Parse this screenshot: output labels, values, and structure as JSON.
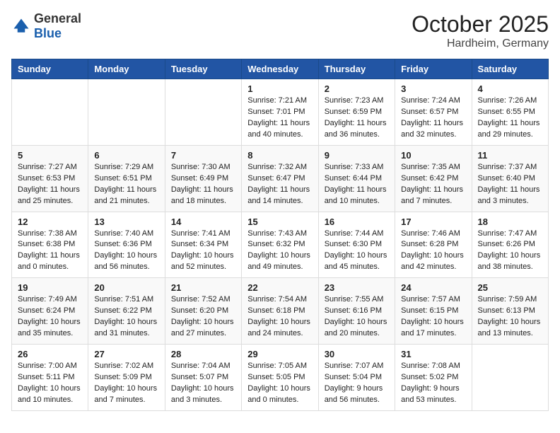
{
  "header": {
    "logo_general": "General",
    "logo_blue": "Blue",
    "month": "October 2025",
    "location": "Hardheim, Germany"
  },
  "weekdays": [
    "Sunday",
    "Monday",
    "Tuesday",
    "Wednesday",
    "Thursday",
    "Friday",
    "Saturday"
  ],
  "weeks": [
    [
      {
        "day": "",
        "info": ""
      },
      {
        "day": "",
        "info": ""
      },
      {
        "day": "",
        "info": ""
      },
      {
        "day": "1",
        "info": "Sunrise: 7:21 AM\nSunset: 7:01 PM\nDaylight: 11 hours\nand 40 minutes."
      },
      {
        "day": "2",
        "info": "Sunrise: 7:23 AM\nSunset: 6:59 PM\nDaylight: 11 hours\nand 36 minutes."
      },
      {
        "day": "3",
        "info": "Sunrise: 7:24 AM\nSunset: 6:57 PM\nDaylight: 11 hours\nand 32 minutes."
      },
      {
        "day": "4",
        "info": "Sunrise: 7:26 AM\nSunset: 6:55 PM\nDaylight: 11 hours\nand 29 minutes."
      }
    ],
    [
      {
        "day": "5",
        "info": "Sunrise: 7:27 AM\nSunset: 6:53 PM\nDaylight: 11 hours\nand 25 minutes."
      },
      {
        "day": "6",
        "info": "Sunrise: 7:29 AM\nSunset: 6:51 PM\nDaylight: 11 hours\nand 21 minutes."
      },
      {
        "day": "7",
        "info": "Sunrise: 7:30 AM\nSunset: 6:49 PM\nDaylight: 11 hours\nand 18 minutes."
      },
      {
        "day": "8",
        "info": "Sunrise: 7:32 AM\nSunset: 6:47 PM\nDaylight: 11 hours\nand 14 minutes."
      },
      {
        "day": "9",
        "info": "Sunrise: 7:33 AM\nSunset: 6:44 PM\nDaylight: 11 hours\nand 10 minutes."
      },
      {
        "day": "10",
        "info": "Sunrise: 7:35 AM\nSunset: 6:42 PM\nDaylight: 11 hours\nand 7 minutes."
      },
      {
        "day": "11",
        "info": "Sunrise: 7:37 AM\nSunset: 6:40 PM\nDaylight: 11 hours\nand 3 minutes."
      }
    ],
    [
      {
        "day": "12",
        "info": "Sunrise: 7:38 AM\nSunset: 6:38 PM\nDaylight: 11 hours\nand 0 minutes."
      },
      {
        "day": "13",
        "info": "Sunrise: 7:40 AM\nSunset: 6:36 PM\nDaylight: 10 hours\nand 56 minutes."
      },
      {
        "day": "14",
        "info": "Sunrise: 7:41 AM\nSunset: 6:34 PM\nDaylight: 10 hours\nand 52 minutes."
      },
      {
        "day": "15",
        "info": "Sunrise: 7:43 AM\nSunset: 6:32 PM\nDaylight: 10 hours\nand 49 minutes."
      },
      {
        "day": "16",
        "info": "Sunrise: 7:44 AM\nSunset: 6:30 PM\nDaylight: 10 hours\nand 45 minutes."
      },
      {
        "day": "17",
        "info": "Sunrise: 7:46 AM\nSunset: 6:28 PM\nDaylight: 10 hours\nand 42 minutes."
      },
      {
        "day": "18",
        "info": "Sunrise: 7:47 AM\nSunset: 6:26 PM\nDaylight: 10 hours\nand 38 minutes."
      }
    ],
    [
      {
        "day": "19",
        "info": "Sunrise: 7:49 AM\nSunset: 6:24 PM\nDaylight: 10 hours\nand 35 minutes."
      },
      {
        "day": "20",
        "info": "Sunrise: 7:51 AM\nSunset: 6:22 PM\nDaylight: 10 hours\nand 31 minutes."
      },
      {
        "day": "21",
        "info": "Sunrise: 7:52 AM\nSunset: 6:20 PM\nDaylight: 10 hours\nand 27 minutes."
      },
      {
        "day": "22",
        "info": "Sunrise: 7:54 AM\nSunset: 6:18 PM\nDaylight: 10 hours\nand 24 minutes."
      },
      {
        "day": "23",
        "info": "Sunrise: 7:55 AM\nSunset: 6:16 PM\nDaylight: 10 hours\nand 20 minutes."
      },
      {
        "day": "24",
        "info": "Sunrise: 7:57 AM\nSunset: 6:15 PM\nDaylight: 10 hours\nand 17 minutes."
      },
      {
        "day": "25",
        "info": "Sunrise: 7:59 AM\nSunset: 6:13 PM\nDaylight: 10 hours\nand 13 minutes."
      }
    ],
    [
      {
        "day": "26",
        "info": "Sunrise: 7:00 AM\nSunset: 5:11 PM\nDaylight: 10 hours\nand 10 minutes."
      },
      {
        "day": "27",
        "info": "Sunrise: 7:02 AM\nSunset: 5:09 PM\nDaylight: 10 hours\nand 7 minutes."
      },
      {
        "day": "28",
        "info": "Sunrise: 7:04 AM\nSunset: 5:07 PM\nDaylight: 10 hours\nand 3 minutes."
      },
      {
        "day": "29",
        "info": "Sunrise: 7:05 AM\nSunset: 5:05 PM\nDaylight: 10 hours\nand 0 minutes."
      },
      {
        "day": "30",
        "info": "Sunrise: 7:07 AM\nSunset: 5:04 PM\nDaylight: 9 hours\nand 56 minutes."
      },
      {
        "day": "31",
        "info": "Sunrise: 7:08 AM\nSunset: 5:02 PM\nDaylight: 9 hours\nand 53 minutes."
      },
      {
        "day": "",
        "info": ""
      }
    ]
  ]
}
